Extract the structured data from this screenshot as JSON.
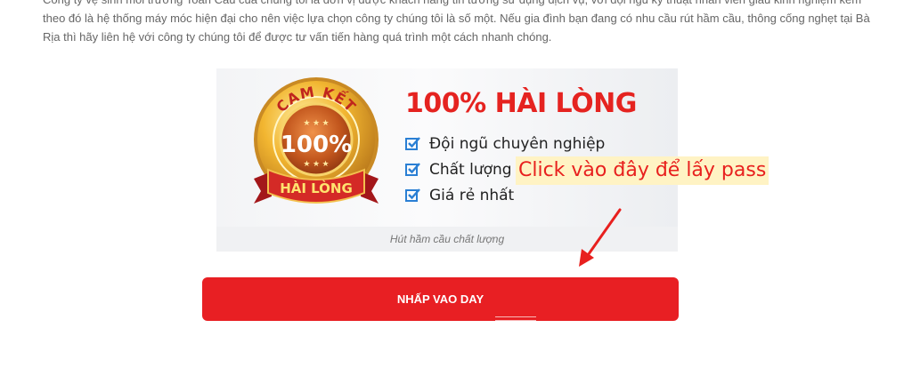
{
  "intro": {
    "text": "Công ty vệ sinh môi trường Toàn Cầu của chúng tôi là đơn vị được khách hàng tin tưởng sử dụng dịch vụ, với đội ngũ kỹ thuật nhân viên giàu kinh nghiệm kèm theo đó là hệ thống máy móc hiện đại cho nên việc lựa chọn công ty chúng tôi là số một. Nếu gia đình bạn đang có nhu cầu rút hầm cầu, thông cống nghẹt tại Bà Rịa thì hãy liên hệ với công ty chúng tôi để được tư vấn tiến hàng quá trình một cách nhanh chóng."
  },
  "banner": {
    "badge_top": "CAM KẾT",
    "badge_percent": "100%",
    "badge_ribbon": "HÀI LÒNG",
    "headline": "100% HÀI LÒNG",
    "features": [
      {
        "text": "Đội ngũ chuyên nghiệp",
        "icon": "checkbox-icon"
      },
      {
        "text": "Chất lượng cao",
        "icon": "checkbox-icon"
      },
      {
        "text": "Giá rẻ nhất",
        "icon": "checkbox-icon"
      }
    ],
    "caption": "Hút hầm cầu chất lượng"
  },
  "annotation": {
    "text": "Click vào đây để lấy pass"
  },
  "cta": {
    "label": "NHẤP VAO DAY"
  },
  "colors": {
    "accent": "#e81f23",
    "gold": "#e6a23c",
    "text": "#666666"
  }
}
